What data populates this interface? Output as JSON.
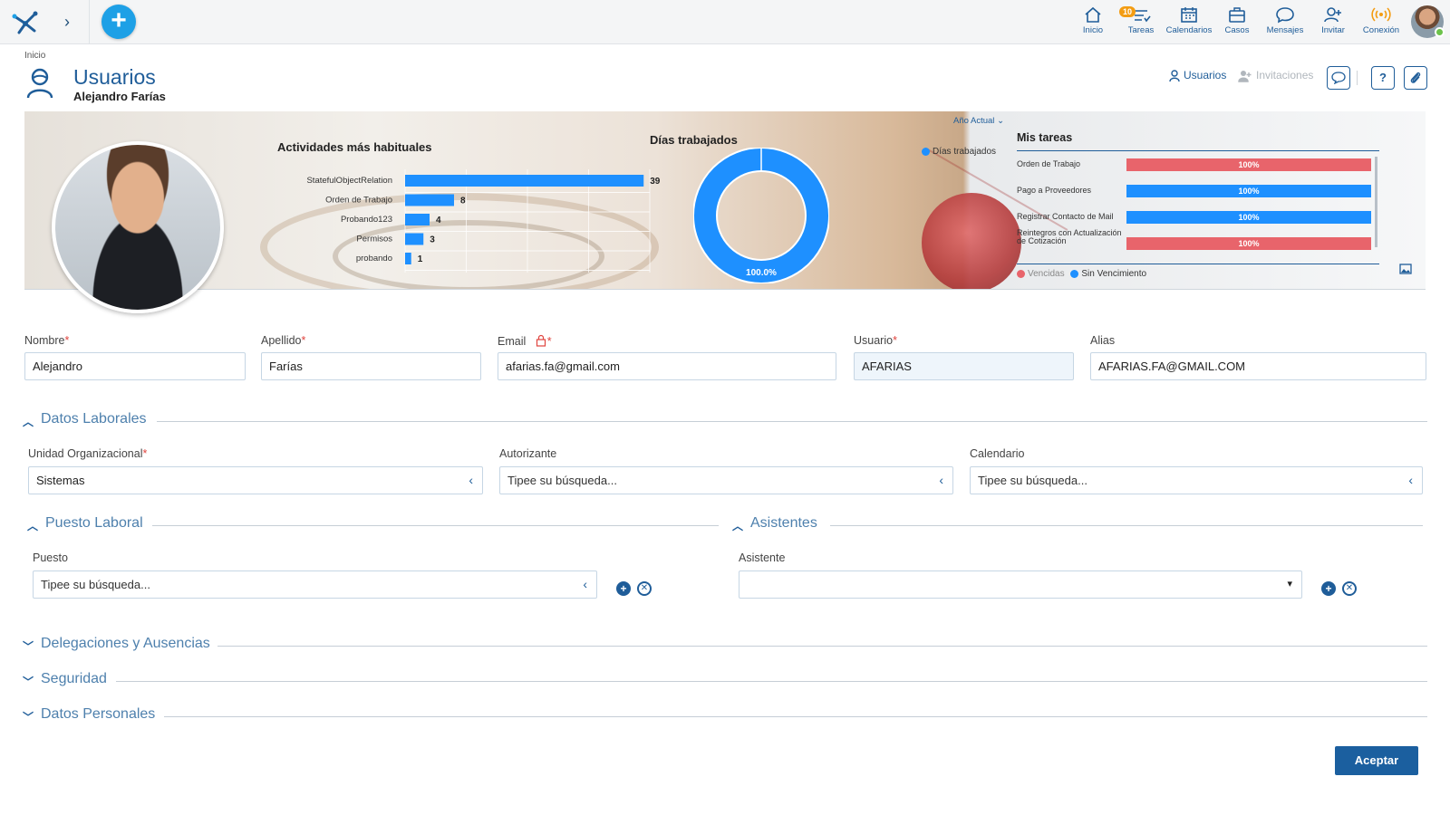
{
  "topbar": {
    "nav": [
      {
        "label": "Inicio",
        "icon": "home-icon"
      },
      {
        "label": "Tareas",
        "icon": "tasks-icon",
        "badge": "10"
      },
      {
        "label": "Calendarios",
        "icon": "calendar-icon"
      },
      {
        "label": "Casos",
        "icon": "briefcase-icon"
      },
      {
        "label": "Mensajes",
        "icon": "chat-icon"
      },
      {
        "label": "Invitar",
        "icon": "invite-icon"
      },
      {
        "label": "Conexión",
        "icon": "signal-icon"
      }
    ]
  },
  "header": {
    "breadcrumb": "Inicio",
    "title": "Usuarios",
    "subtitle": "Alejandro Farías",
    "links": {
      "users": "Usuarios",
      "invitations": "Invitaciones"
    },
    "help": "?"
  },
  "banner": {
    "activities_title": "Actividades más habituales",
    "days_title": "Días trabajados",
    "tasks_title": "Mis tareas",
    "year_filter": "Año Actual",
    "days_legend": "Días trabajados",
    "donut_label": "100.0%",
    "tasks_legend": {
      "overdue": "Vencidas",
      "no_due": "Sin Vencimiento"
    },
    "colors": {
      "blue": "#1e90ff",
      "red": "#e8646b"
    }
  },
  "chart_data": [
    {
      "type": "bar",
      "title": "Actividades más habituales",
      "categories": [
        "StatefulObjectRelation",
        "Orden de Trabajo",
        "Probando123",
        "Permisos",
        "probando"
      ],
      "values": [
        39,
        8,
        4,
        3,
        1
      ],
      "xlim": [
        0,
        40
      ]
    },
    {
      "type": "pie",
      "title": "Días trabajados",
      "labels": [
        "Días trabajados"
      ],
      "values": [
        100.0
      ]
    },
    {
      "type": "bar",
      "title": "Mis tareas",
      "categories": [
        "Orden de Trabajo",
        "Pago a Proveedores",
        "Registrar Contacto de Mail",
        "Reintegros con Actualización de Cotización"
      ],
      "values": [
        100,
        100,
        100,
        100
      ],
      "value_labels": [
        "100%",
        "100%",
        "100%",
        "100%"
      ],
      "status": [
        "Vencidas",
        "Sin Vencimiento",
        "Sin Vencimiento",
        "Vencidas"
      ]
    }
  ],
  "form": {
    "nombre": {
      "label": "Nombre",
      "value": "Alejandro"
    },
    "apellido": {
      "label": "Apellido",
      "value": "Farías"
    },
    "email": {
      "label": "Email",
      "value": "afarias.fa@gmail.com"
    },
    "usuario": {
      "label": "Usuario",
      "value": "AFARIAS"
    },
    "alias": {
      "label": "Alias",
      "value": "AFARIAS.FA@GMAIL.COM"
    },
    "required_mark": "*"
  },
  "sections": {
    "laborales": "Datos Laborales",
    "puesto": "Puesto Laboral",
    "asistentes": "Asistentes",
    "delegaciones": "Delegaciones y Ausencias",
    "seguridad": "Seguridad",
    "personales": "Datos Personales"
  },
  "laborales": {
    "unidad": {
      "label": "Unidad Organizacional",
      "value": "Sistemas"
    },
    "autorizante": {
      "label": "Autorizante",
      "value": "Tipee su búsqueda..."
    },
    "calendario": {
      "label": "Calendario",
      "value": "Tipee su búsqueda..."
    }
  },
  "puesto": {
    "label": "Puesto",
    "value": "Tipee su búsqueda..."
  },
  "asistentes": {
    "label": "Asistente",
    "value": ""
  },
  "actions": {
    "accept": "Aceptar"
  }
}
